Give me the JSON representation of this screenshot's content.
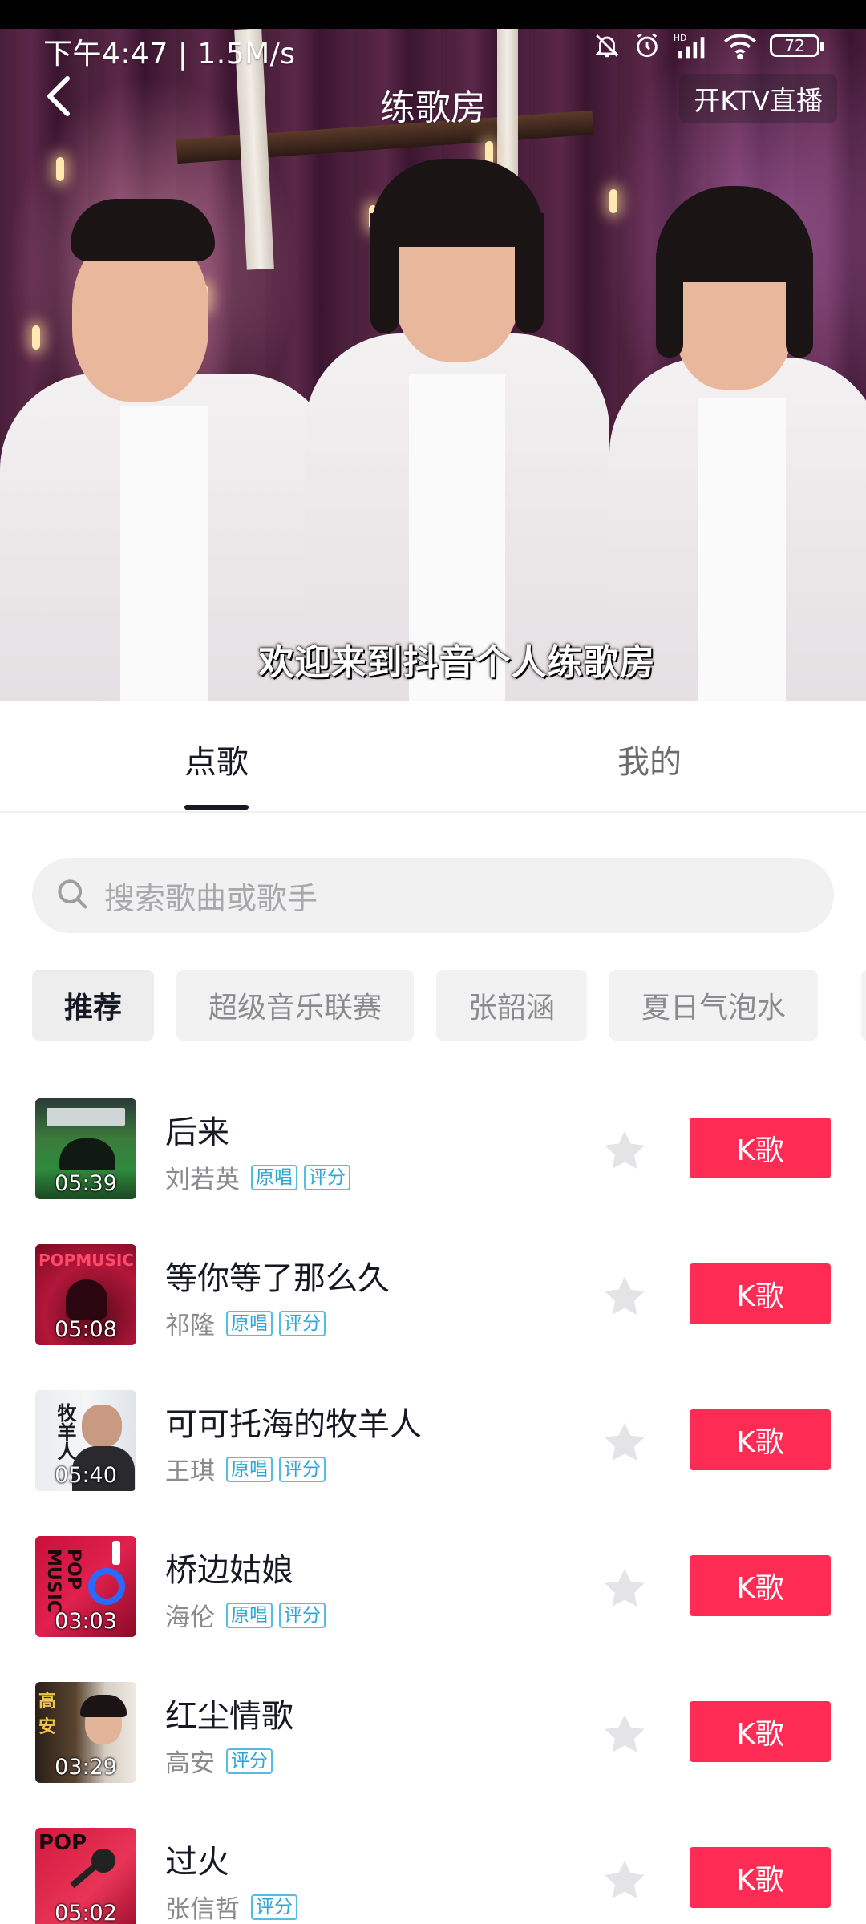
{
  "status_bar": {
    "time": "下午4:47 | 1.5M/s",
    "battery": "72"
  },
  "nav": {
    "title": "练歌房",
    "ktv_live": "开KTV直播"
  },
  "video": {
    "subtitle": "欢迎来到抖音个人练歌房"
  },
  "tabs": [
    {
      "label": "点歌",
      "active": true
    },
    {
      "label": "我的",
      "active": false
    }
  ],
  "search": {
    "placeholder": "搜索歌曲或歌手"
  },
  "chips": [
    "推荐",
    "超级音乐联赛",
    "张韶涵",
    "夏日气泡水"
  ],
  "songs": [
    {
      "title": "后来",
      "artist": "刘若英",
      "tags": [
        "原唱",
        "评分"
      ],
      "duration": "05:39",
      "button": "K歌"
    },
    {
      "title": "等你等了那么久",
      "artist": "祁隆",
      "tags": [
        "原唱",
        "评分"
      ],
      "duration": "05:08",
      "button": "K歌",
      "cover_text": "POPMUSIC"
    },
    {
      "title": "可可托海的牧羊人",
      "artist": "王琪",
      "tags": [
        "原唱",
        "评分"
      ],
      "duration": "05:40",
      "button": "K歌",
      "cover_text": "牧羊人"
    },
    {
      "title": "桥边姑娘",
      "artist": "海伦",
      "tags": [
        "原唱",
        "评分"
      ],
      "duration": "03:03",
      "button": "K歌",
      "cover_text": "POP MUSIC"
    },
    {
      "title": "红尘情歌",
      "artist": "高安",
      "tags": [
        "评分"
      ],
      "duration": "03:29",
      "button": "K歌",
      "cover_text": "高安"
    },
    {
      "title": "过火",
      "artist": "张信哲",
      "tags": [
        "评分"
      ],
      "duration": "05:02",
      "button": "K歌",
      "cover_text": "POP"
    }
  ],
  "colors": {
    "accent": "#fe2c55",
    "tag": "#2aa7d6"
  },
  "icons": {
    "back": "chevron-left-icon",
    "search": "search-icon",
    "favorite": "star-icon"
  }
}
